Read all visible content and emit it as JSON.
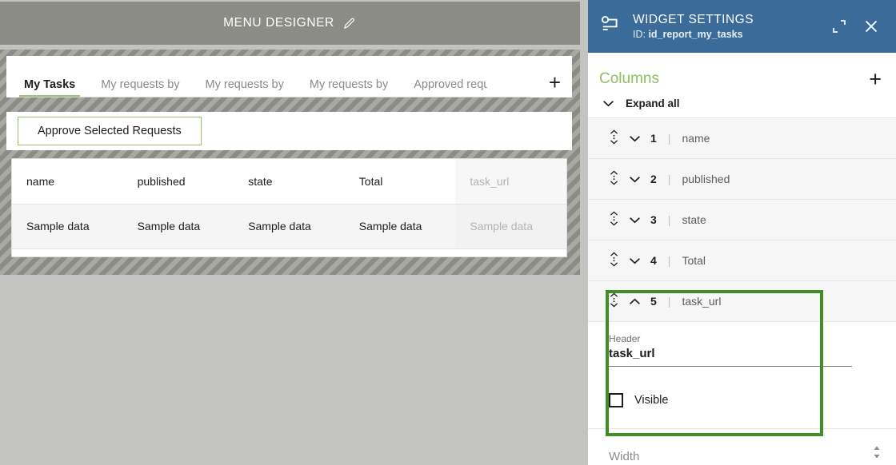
{
  "designer": {
    "title": "MENU DESIGNER",
    "edit_icon": "pencil-icon",
    "tabs": [
      {
        "label": "My Tasks",
        "active": true
      },
      {
        "label": "My requests by",
        "active": false
      },
      {
        "label": "My requests by",
        "active": false
      },
      {
        "label": "My requests by",
        "active": false
      },
      {
        "label": "Approved reque",
        "active": false,
        "truncated": true
      }
    ],
    "add_tab_label": "+",
    "toolbar": {
      "approve_button": "Approve Selected Requests"
    },
    "table": {
      "columns": [
        {
          "header": "name",
          "hidden": false
        },
        {
          "header": "published",
          "hidden": false
        },
        {
          "header": "state",
          "hidden": false
        },
        {
          "header": "Total",
          "hidden": false
        },
        {
          "header": "task_url",
          "hidden": true
        }
      ],
      "rows": [
        [
          "Sample data",
          "Sample data",
          "Sample data",
          "Sample data",
          "Sample data"
        ]
      ]
    }
  },
  "panel": {
    "icon": "widget-icon",
    "title": "WIDGET SETTINGS",
    "id_prefix": "ID: ",
    "id_value": "id_report_my_tasks",
    "expand_icon": "expand-icon",
    "close_icon": "close-icon",
    "section": {
      "title": "Columns",
      "add_label": "+",
      "expand_all_label": "Expand all"
    },
    "columns": [
      {
        "index": "1",
        "name": "name",
        "expanded": false
      },
      {
        "index": "2",
        "name": "published",
        "expanded": false
      },
      {
        "index": "3",
        "name": "state",
        "expanded": false
      },
      {
        "index": "4",
        "name": "Total",
        "expanded": false
      },
      {
        "index": "5",
        "name": "task_url",
        "expanded": true
      }
    ],
    "expanded_detail": {
      "header_label": "Header",
      "header_value": "task_url",
      "visible_label": "Visible",
      "visible_checked": false
    },
    "width_field": {
      "placeholder": "Width",
      "value": ""
    }
  },
  "colors": {
    "panel_header_blue": "#3a6b99",
    "accent_green": "#8fbf60",
    "annotation_green": "#3f8f25",
    "canvas_gray": "#c3c3c1",
    "titlebar_gray": "#8c8c87"
  }
}
